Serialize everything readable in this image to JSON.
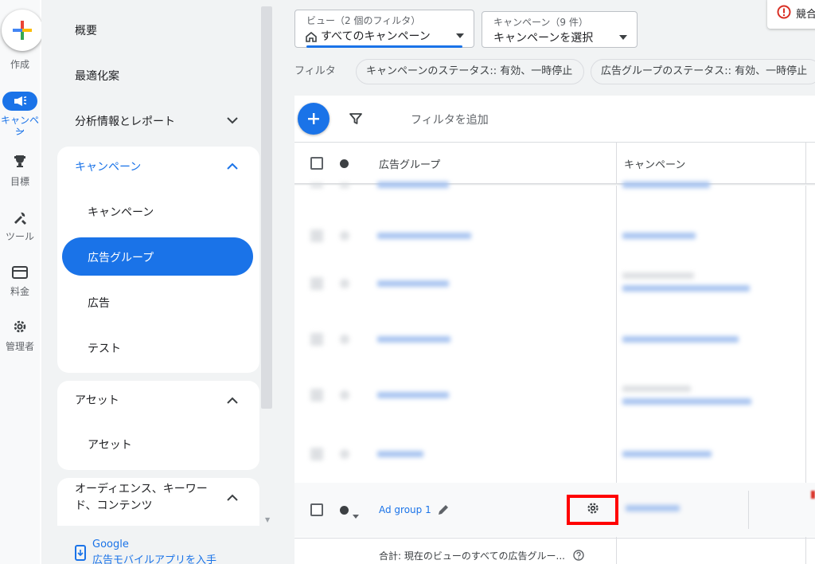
{
  "rail": {
    "create_label": "作成",
    "campaign_label_1": "キャンペー",
    "campaign_label_2": "ン",
    "goals_label": "目標",
    "tools_label": "ツール",
    "billing_label": "料金",
    "admin_label": "管理者"
  },
  "nav": {
    "overview": "概要",
    "recommendations": "最適化案",
    "insights": "分析情報とレポート",
    "campaigns_section": {
      "title": "キャンペーン",
      "items": [
        "キャンペーン",
        "広告グループ",
        "広告",
        "テスト"
      ]
    },
    "assets_section": {
      "title": "アセット",
      "items": [
        "アセット"
      ]
    },
    "audience_section": {
      "title_line1": "オーディエンス、キーワー",
      "title_line2": "ド、コンテンツ"
    },
    "promo_line1": "Google",
    "promo_line2": "広告モバイルアプリを入手"
  },
  "toolbar": {
    "view_label": "ビュー（2 個のフィルタ）",
    "view_value": "すべてのキャンペーン",
    "campaign_label": "キャンペーン（9 件）",
    "campaign_value": "キャンペーンを選択",
    "alert_text": "競合"
  },
  "filters": {
    "label": "フィルタ",
    "chips": [
      "キャンペーンのステータス:: 有効、一時停止",
      "広告グループのステータス:: 有効、一時停止"
    ],
    "add_filter": "フィルタを追加"
  },
  "table": {
    "col_adgroup": "広告グループ",
    "col_campaign": "キャンペーン",
    "visible_row": {
      "name": "Ad group 1"
    },
    "footer": "合計: 現在のビューのすべての広告グルー..."
  },
  "colors": {
    "accent": "#1a73e8",
    "highlight_box": "#ff0000"
  }
}
